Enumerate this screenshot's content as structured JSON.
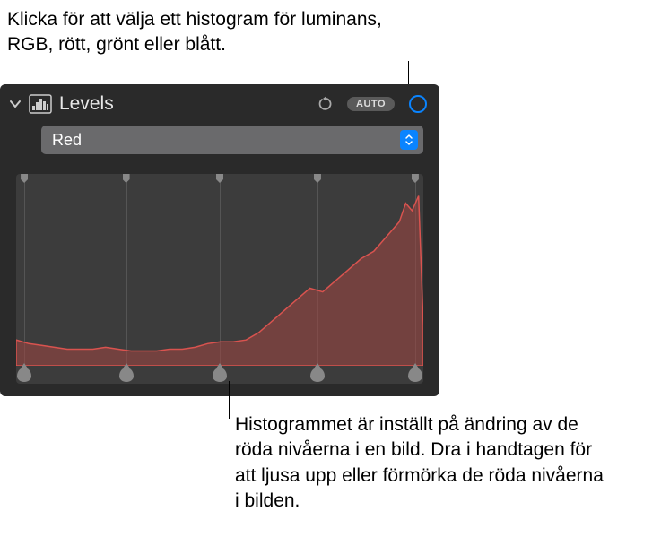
{
  "annotations": {
    "top": "Klicka för att välja ett histogram för luminans, RGB, rött, grönt eller blått.",
    "bottom": "Histogrammet är inställt på ändring av de röda nivåerna i en bild. Dra i handtagen för att ljusa upp eller förmörka de röda nivåerna i bilden."
  },
  "panel": {
    "title": "Levels",
    "dropdown_value": "Red",
    "auto_label": "AUTO"
  },
  "handles": {
    "positions_pct": [
      2,
      27,
      50,
      74,
      98
    ]
  },
  "chart_data": {
    "type": "area",
    "title": "Red channel histogram",
    "xlabel": "",
    "ylabel": "",
    "xlim": [
      0,
      255
    ],
    "ylim": [
      0,
      100
    ],
    "color": "#d9534f",
    "fill": "rgba(160,70,65,0.55)",
    "x": [
      0,
      8,
      16,
      24,
      32,
      40,
      48,
      56,
      64,
      72,
      80,
      88,
      96,
      104,
      112,
      120,
      128,
      136,
      144,
      152,
      160,
      168,
      176,
      184,
      192,
      200,
      208,
      216,
      224,
      232,
      240,
      244,
      248,
      252,
      255
    ],
    "values": [
      14,
      12,
      11,
      10,
      9,
      9,
      9,
      10,
      9,
      8,
      8,
      8,
      9,
      9,
      10,
      12,
      13,
      13,
      14,
      18,
      24,
      30,
      36,
      42,
      40,
      46,
      52,
      58,
      62,
      70,
      78,
      88,
      84,
      92,
      22
    ]
  }
}
